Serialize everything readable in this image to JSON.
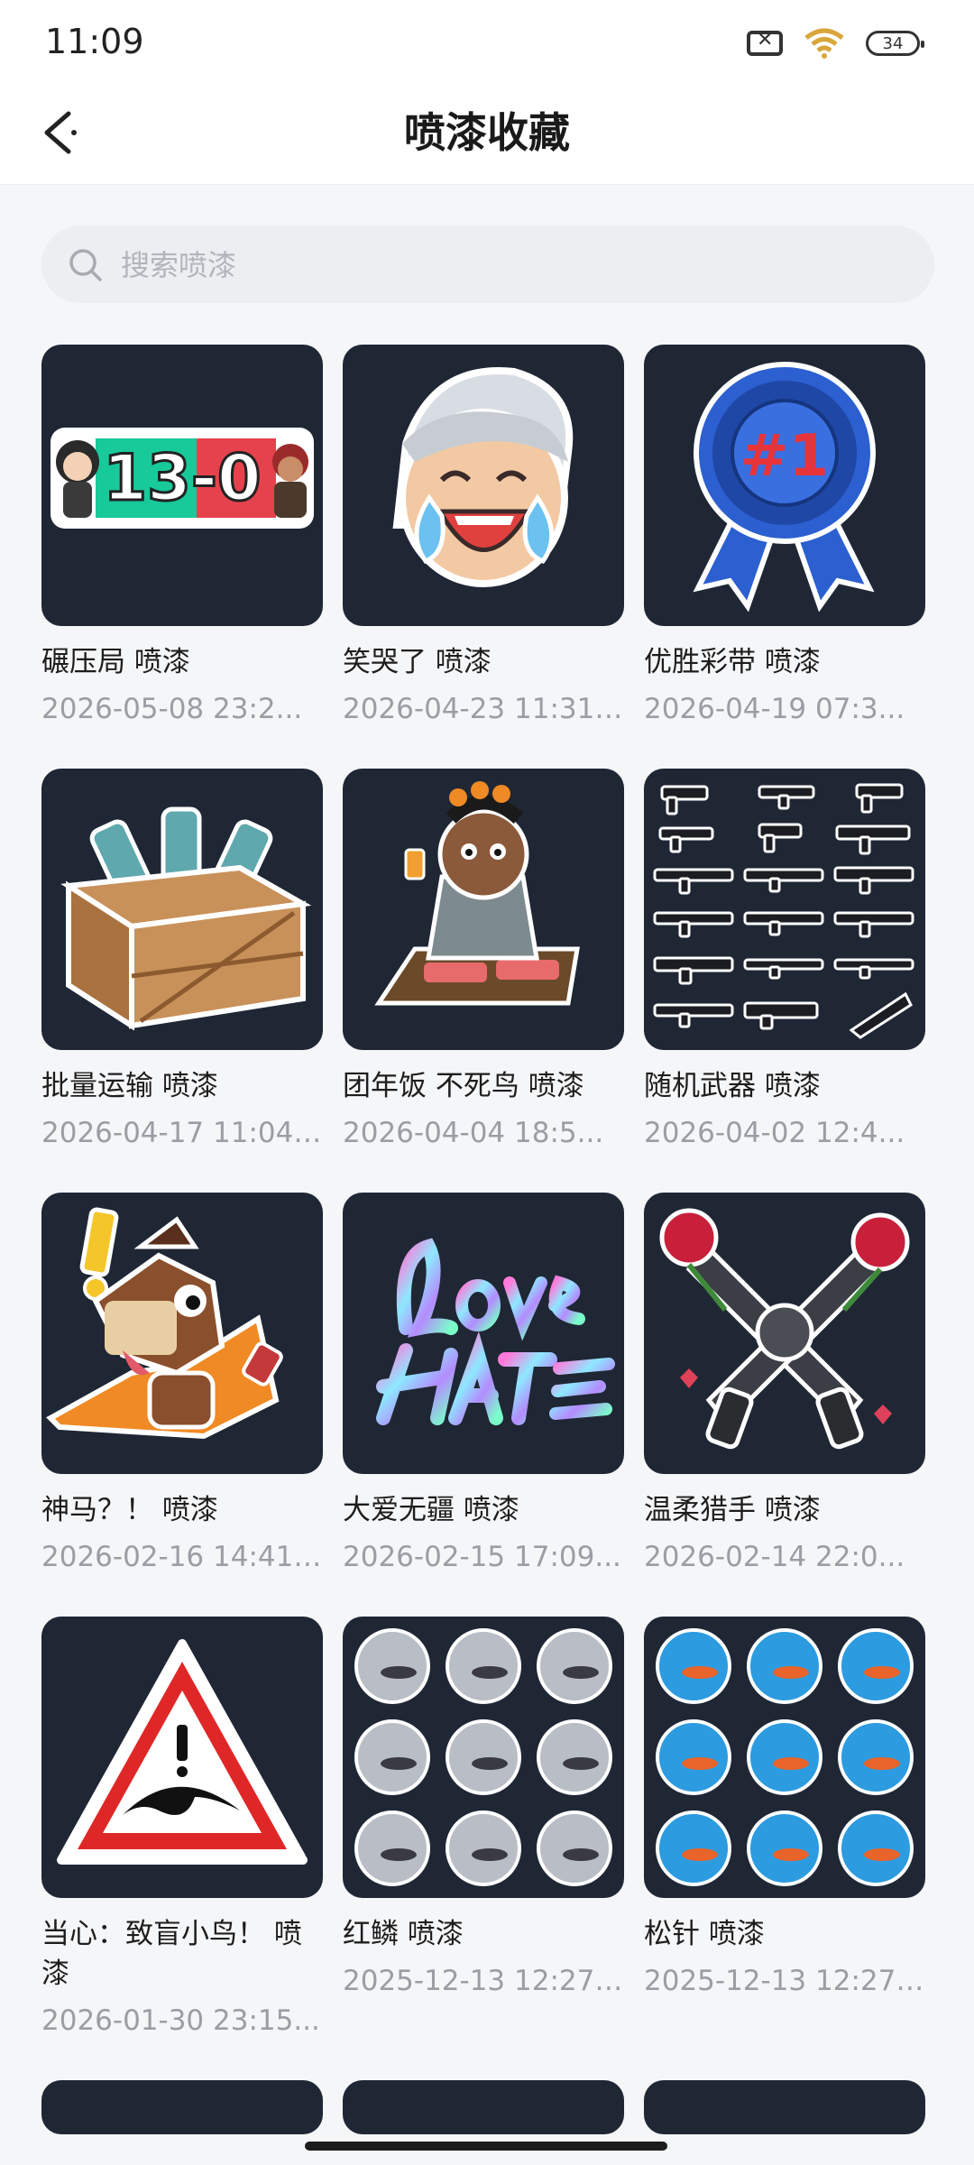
{
  "status_bar": {
    "time": "11:09",
    "battery": "34"
  },
  "header": {
    "title": "喷漆收藏"
  },
  "search": {
    "placeholder": "搜索喷漆"
  },
  "colors": {
    "tile_bg": "#1f2735",
    "page_bg": "#f5f6f8"
  },
  "sprays": [
    {
      "name": "碾压局 喷漆",
      "date": "2026-05-08 23:2...",
      "icon": "score-13-0-icon"
    },
    {
      "name": "笑哭了 喷漆",
      "date": "2026-04-23 11:31:...",
      "icon": "laughing-crying-face-icon"
    },
    {
      "name": "优胜彩带 喷漆",
      "date": "2026-04-19 07:3...",
      "icon": "blue-ribbon-rank-1-icon"
    },
    {
      "name": "批量运输 喷漆",
      "date": "2026-04-17 11:04:...",
      "icon": "crate-of-canisters-icon"
    },
    {
      "name": "团年饭 不死鸟 喷漆",
      "date": "2026-04-04 18:5...",
      "icon": "new-year-dinner-character-icon"
    },
    {
      "name": "随机武器 喷漆",
      "date": "2026-04-02 12:4...",
      "icon": "weapons-grid-icon"
    },
    {
      "name": "神马？！ 喷漆",
      "date": "2026-02-16 14:41:...",
      "icon": "surprised-horse-icon"
    },
    {
      "name": "大爱无疆 喷漆",
      "date": "2026-02-15 17:09...",
      "icon": "love-over-hate-text-icon"
    },
    {
      "name": "温柔猎手 喷漆",
      "date": "2026-02-14 22:0...",
      "icon": "crossed-pistols-roses-icon"
    },
    {
      "name": "当心：致盲小鸟！ 喷漆",
      "date": "2026-01-30 23:15...",
      "icon": "warning-triangle-bird-icon"
    },
    {
      "name": "红鳞 喷漆",
      "date": "2025-12-13 12:27:...",
      "icon": "grey-waves-koi-icon"
    },
    {
      "name": "松针 喷漆",
      "date": "2025-12-13 12:27:...",
      "icon": "blue-waves-koi-icon"
    }
  ]
}
